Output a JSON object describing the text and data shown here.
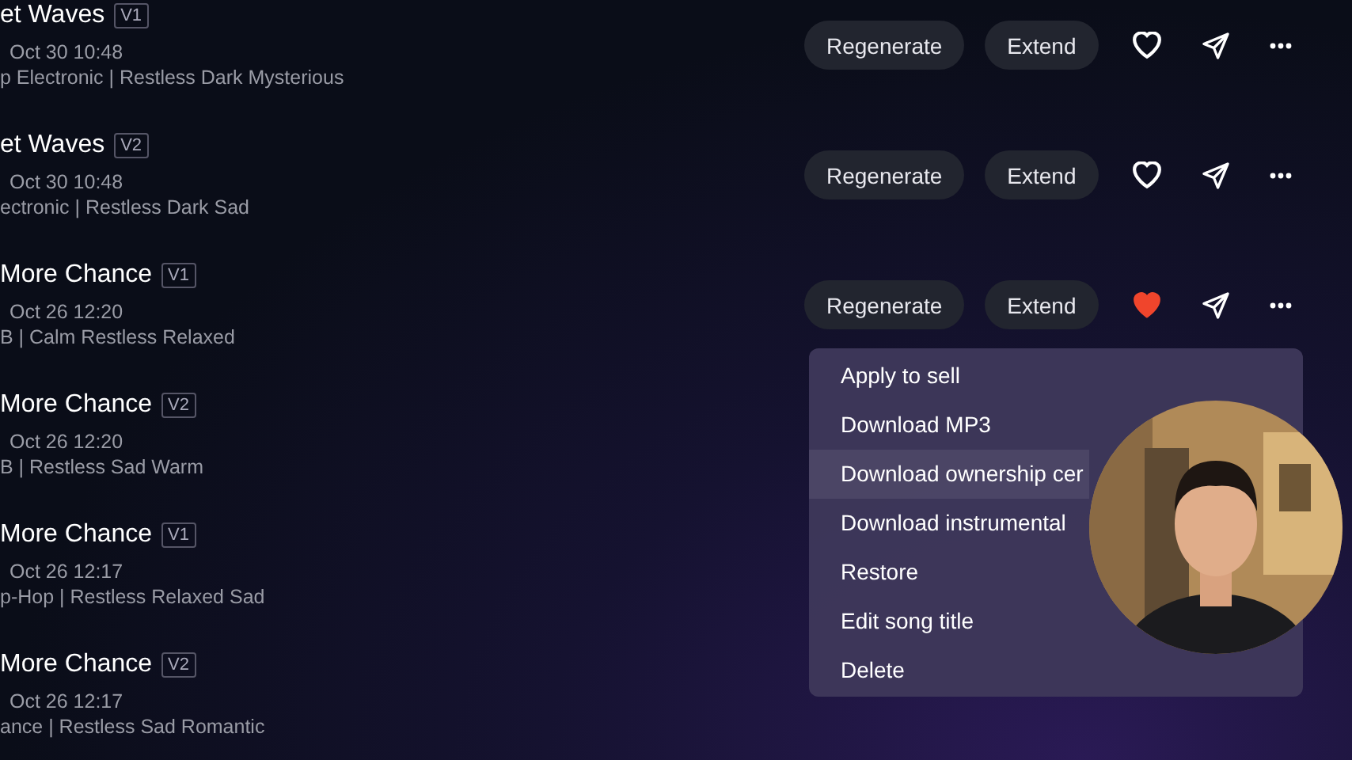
{
  "songs": [
    {
      "title": "et Waves",
      "version": "V1",
      "date": "Oct 30 10:48",
      "tags": "p Electronic  | Restless Dark Mysterious",
      "actions": [
        "Regenerate",
        "Extend"
      ],
      "liked": false
    },
    {
      "title": "et Waves",
      "version": "V2",
      "date": "Oct 30 10:48",
      "tags": "ectronic  | Restless Dark Sad",
      "actions": [
        "Regenerate",
        "Extend"
      ],
      "liked": false
    },
    {
      "title": "More Chance",
      "version": "V1",
      "date": "Oct 26 12:20",
      "tags": "B  | Calm Restless Relaxed",
      "actions": [
        "Regenerate",
        "Extend"
      ],
      "liked": true
    },
    {
      "title": "More Chance",
      "version": "V2",
      "date": "Oct 26 12:20",
      "tags": "B  | Restless Sad Warm"
    },
    {
      "title": "More Chance",
      "version": "V1",
      "date": "Oct 26 12:17",
      "tags": "p-Hop  | Restless Relaxed Sad"
    },
    {
      "title": "More Chance",
      "version": "V2",
      "date": "Oct 26 12:17",
      "tags": "ance  | Restless Sad Romantic"
    }
  ],
  "menu": [
    {
      "label": "Apply to sell",
      "selected": false
    },
    {
      "label": "Download MP3",
      "selected": false
    },
    {
      "label": "Download ownership cer",
      "selected": true
    },
    {
      "label": "Download instrumental",
      "selected": false
    },
    {
      "label": "Restore",
      "selected": false
    },
    {
      "label": "Edit song title",
      "selected": false
    },
    {
      "label": "Delete",
      "selected": false
    }
  ]
}
